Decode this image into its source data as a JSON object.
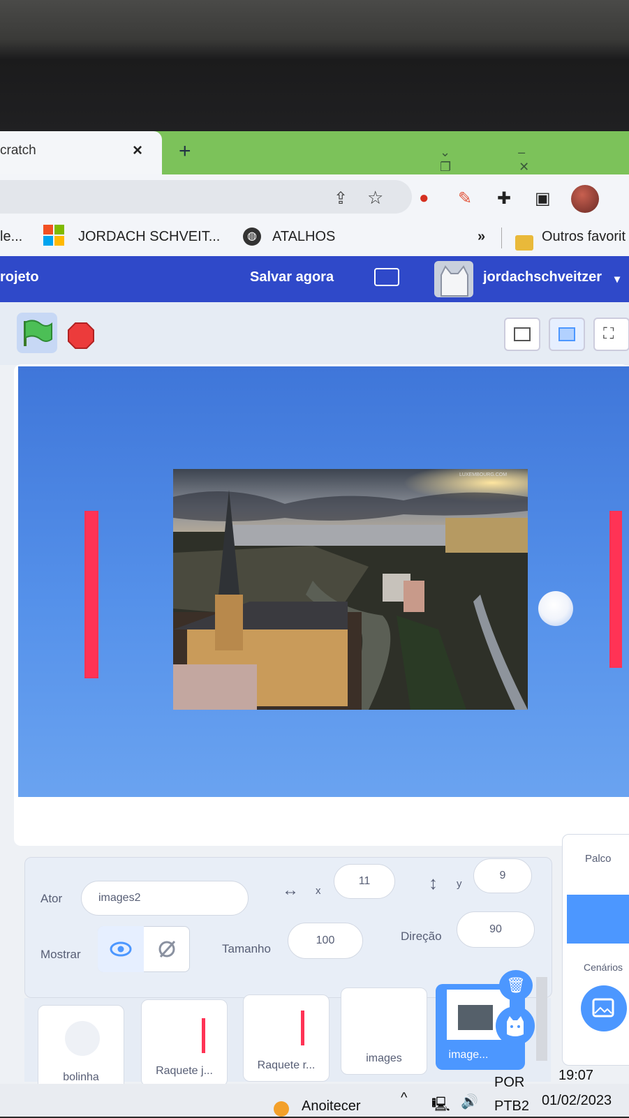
{
  "browser": {
    "tab_title": "cratch",
    "tab_close": "×",
    "new_tab": "+",
    "window_controls": "⌄ – ❐ ✕"
  },
  "bookmarks": {
    "item1": "le...",
    "item2": "JORDACH SCHVEIT...",
    "item3": "ATALHOS",
    "more": "»",
    "other": "Outros favorit"
  },
  "menubar": {
    "project": "rojeto",
    "save_now": "Salvar agora",
    "username": "jordachschveitzer",
    "caret": "▾"
  },
  "sprite_info": {
    "actor_label": "Ator",
    "actor_name": "images2",
    "x_label": "x",
    "x_value": "11",
    "y_label": "y",
    "y_value": "9",
    "show_label": "Mostrar",
    "size_label": "Tamanho",
    "size_value": "100",
    "direction_label": "Direção",
    "direction_value": "90"
  },
  "sprites": [
    {
      "name": "bolinha"
    },
    {
      "name": "Raquete j..."
    },
    {
      "name": "Raquete r..."
    },
    {
      "name": "images"
    },
    {
      "name": "image..."
    }
  ],
  "stage_panel": {
    "title": "Palco",
    "backdrops_label": "Cenários"
  },
  "photo_watermark": "LUXEMBOURG.COM",
  "taskbar": {
    "weather": "Anoitecer",
    "lang_top": "POR",
    "lang_bottom": "PTB2",
    "time": "19:07",
    "date": "01/02/2023"
  },
  "colors": {
    "menubar": "#2f49c9",
    "stage": "#5591ea",
    "paddle": "#ff3355",
    "accent": "#4c97ff"
  }
}
